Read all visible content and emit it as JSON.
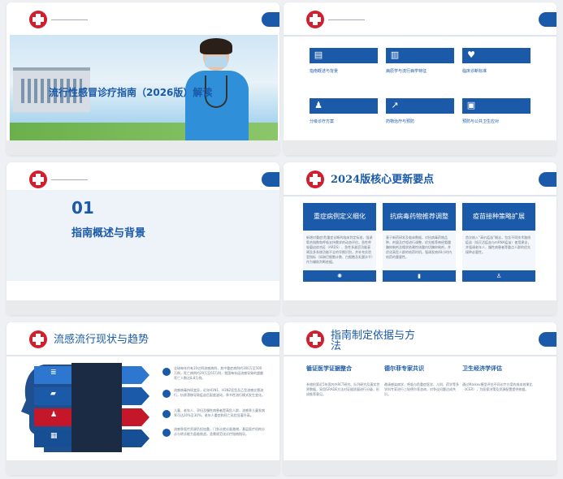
{
  "slide1": {
    "title": "流行性感冒诊疗指南（2026版）解读"
  },
  "slide2": {
    "items": [
      {
        "label": "指南概述与背景",
        "icon": "document-icon"
      },
      {
        "label": "病原学与流行病学特征",
        "icon": "chart-icon"
      },
      {
        "label": "临床诊断标准",
        "icon": "heart-icon"
      },
      {
        "label": "分级诊疗方案",
        "icon": "user-icon"
      },
      {
        "label": "药物治疗与预防",
        "icon": "trend-icon"
      },
      {
        "label": "预防与公共卫生应对",
        "icon": "camera-icon"
      }
    ]
  },
  "slide3": {
    "number": "01",
    "title": "指南概述与背景"
  },
  "slide4": {
    "title": "2024版核心更新要点",
    "cols": [
      {
        "head": "重症病例定义细化",
        "body": "新增对重症/危重症诊断的临床判定标准，强调氧合指数和呼吸支持需求的动态评估，急性呼吸窘迫综合征（ARDS）、急性多器官功能衰竭及多系统功能不全的早期识别，并补充实验室指标（如淋巴细胞计数、白细胞及乳酸水平）作为辅助判断依据。",
        "icon": "sun-icon"
      },
      {
        "head": "抗病毒药物推荐调整",
        "body": "基于新药研发及临床数据，对抗病毒药物品种、剂量及疗程进行调整，优先推荐神经氨酸酶抑制剂及帽状依赖性核酸内切酶抑制剂，并优化高危人群的给药时机，强调发病48小时内给药的重要性。",
        "icon": "battery-icon"
      },
      {
        "head": "疫苗接种策略扩展",
        "body": "首次纳入“高价疫苗”概念，包含不同技术路线疫苗（如灭活疫苗与mRNA疫苗）使用建议，并强调老年人、慢性病患者等重点人群的优先接种必要性。",
        "icon": "person-icon"
      }
    ]
  },
  "slide5": {
    "title": "流感流行现状与趋势",
    "rows": [
      {
        "text": "全球每年约有10亿例流感病例，其中重症病例约300万至500万例，死亡病例约29万至65万例，我国每年因流感导致的超额死亡人数达8.8万例。",
        "color": "#2e77d0",
        "icon": "layers-icon"
      },
      {
        "text": "流感病毒持续变异，近年H1N1、H3N2亚型及乙型流感交替流行，抗原漂移导致疫苗匹配度波动，季节性流行模式发生变化。",
        "color": "#1a5aa8",
        "icon": "car-icon"
      },
      {
        "text": "儿童、老年人、孕妇及慢性病患者是高危人群，流感季儿童发病率可达20%至30%，老年人重症和死亡风险显著升高。",
        "color": "#d11f2e",
        "icon": "people-icon"
      },
      {
        "text": "流感季医疗资源负担加重，门急诊就诊量激增，基层医疗机构分诊与转诊能力面临挑战，亟需规范化诊疗指南指导。",
        "color": "#174f94",
        "icon": "box-icon"
      }
    ]
  },
  "slide6": {
    "title": "指南制定依据与方法",
    "cols": [
      {
        "head": "循证医学证据整合",
        "body": "系统检索近5年国内外RCT研究、队列研究及真实世界数据，采用GRADE方法对证据质量进行分级，形成推荐意见。"
      },
      {
        "head": "德尔菲专家共识",
        "body": "邀请感染病学、呼吸与危重症医学、儿科、药学等多学科专家进行三轮德尔菲咨询，对争议问题达成共识。"
      },
      {
        "head": "卫生经济学评估",
        "body": "通过Markov模型评估不同诊疗方案的成本效果比（ICER），为医保决策及资源配置提供依据。"
      }
    ]
  }
}
